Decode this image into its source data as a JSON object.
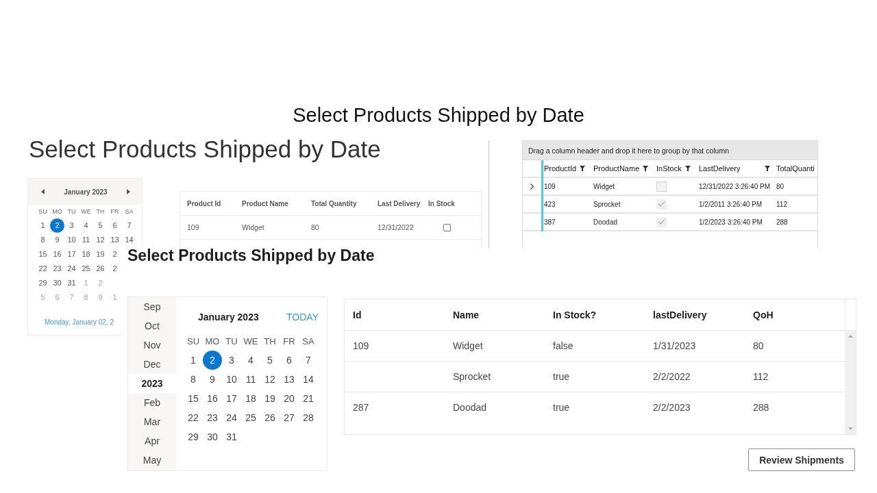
{
  "slide": {
    "title": "Select Products Shipped by Date"
  },
  "top_left_screenshot": {
    "heading": "Select Products Shipped by Date",
    "calendar": {
      "month": "January 2023",
      "weekdays": [
        "SU",
        "MO",
        "TU",
        "WE",
        "TH",
        "FR",
        "SA"
      ],
      "weeks": [
        [
          {
            "day": "1",
            "selected": false,
            "outside": false
          },
          {
            "day": "2",
            "selected": true,
            "outside": false
          },
          {
            "day": "3",
            "selected": false,
            "outside": false
          },
          {
            "day": "4",
            "selected": false,
            "outside": false
          },
          {
            "day": "5",
            "selected": false,
            "outside": false
          },
          {
            "day": "6",
            "selected": false,
            "outside": false
          },
          {
            "day": "7",
            "selected": false,
            "outside": false
          }
        ],
        [
          {
            "day": "8",
            "selected": false,
            "outside": false
          },
          {
            "day": "9",
            "selected": false,
            "outside": false
          },
          {
            "day": "10",
            "selected": false,
            "outside": false
          },
          {
            "day": "11",
            "selected": false,
            "outside": false
          },
          {
            "day": "12",
            "selected": false,
            "outside": false
          },
          {
            "day": "13",
            "selected": false,
            "outside": false
          },
          {
            "day": "14",
            "selected": false,
            "outside": false
          }
        ],
        [
          {
            "day": "15",
            "selected": false,
            "outside": false
          },
          {
            "day": "16",
            "selected": false,
            "outside": false
          },
          {
            "day": "17",
            "selected": false,
            "outside": false
          },
          {
            "day": "18",
            "selected": false,
            "outside": false
          },
          {
            "day": "19",
            "selected": false,
            "outside": false
          },
          {
            "day": "2",
            "selected": false,
            "outside": false
          }
        ],
        [
          {
            "day": "22",
            "selected": false,
            "outside": false
          },
          {
            "day": "23",
            "selected": false,
            "outside": false
          },
          {
            "day": "24",
            "selected": false,
            "outside": false
          },
          {
            "day": "25",
            "selected": false,
            "outside": false
          },
          {
            "day": "26",
            "selected": false,
            "outside": false
          },
          {
            "day": "2",
            "selected": false,
            "outside": false
          }
        ],
        [
          {
            "day": "29",
            "selected": false,
            "outside": false
          },
          {
            "day": "30",
            "selected": false,
            "outside": false
          },
          {
            "day": "31",
            "selected": false,
            "outside": false
          },
          {
            "day": "1",
            "selected": false,
            "outside": true
          },
          {
            "day": "2",
            "selected": false,
            "outside": true
          }
        ],
        [
          {
            "day": "5",
            "selected": false,
            "outside": true
          },
          {
            "day": "6",
            "selected": false,
            "outside": true
          },
          {
            "day": "7",
            "selected": false,
            "outside": true
          },
          {
            "day": "8",
            "selected": false,
            "outside": true
          },
          {
            "day": "9",
            "selected": false,
            "outside": true
          },
          {
            "day": "1",
            "selected": false,
            "outside": true
          }
        ]
      ],
      "footer_link": "Monday, January 02, 2"
    },
    "table": {
      "columns": [
        {
          "label": "Product Id",
          "kind": "text"
        },
        {
          "label": "Product Name",
          "kind": "text"
        },
        {
          "label": "Total Quantity",
          "kind": "text"
        },
        {
          "label": "Last Delivery",
          "kind": "text"
        },
        {
          "label": "In Stock",
          "kind": "check"
        }
      ],
      "rows": [
        {
          "cells": [
            "109",
            "Widget",
            "80",
            "12/31/2022",
            {
              "checked": false
            }
          ]
        }
      ]
    }
  },
  "top_right_screenshot": {
    "group_hint": "Drag a column header and drop it here to group by that column",
    "columns": [
      {
        "label": "ProductId",
        "kind": "text",
        "filter": true
      },
      {
        "label": "ProductName",
        "kind": "text",
        "filter": true
      },
      {
        "label": "InStock",
        "kind": "check",
        "filter": true
      },
      {
        "label": "LastDelivery",
        "kind": "text",
        "filter": true
      },
      {
        "label": "TotalQuanti",
        "kind": "text",
        "filter": false
      }
    ],
    "rows": [
      {
        "current": true,
        "cells": [
          "109",
          "Widget",
          {
            "checked": false
          },
          "12/31/2022 3:26:40 PM",
          "80"
        ]
      },
      {
        "current": false,
        "cells": [
          "423",
          "Sprocket",
          {
            "checked": true
          },
          "1/2/2011 3:26:40 PM",
          "112"
        ]
      },
      {
        "current": false,
        "cells": [
          "387",
          "Doodad",
          {
            "checked": true
          },
          "1/2/2023 3:26:40 PM",
          "288"
        ]
      }
    ]
  },
  "bottom_screenshot": {
    "heading": "Select Products Shipped by Date",
    "calendar": {
      "months": [
        {
          "label": "Sep",
          "selected": false
        },
        {
          "label": "Oct",
          "selected": false
        },
        {
          "label": "Nov",
          "selected": false
        },
        {
          "label": "Dec",
          "selected": false
        },
        {
          "label": "2023",
          "selected": true
        },
        {
          "label": "Feb",
          "selected": false
        },
        {
          "label": "Mar",
          "selected": false
        },
        {
          "label": "Apr",
          "selected": false
        },
        {
          "label": "May",
          "selected": false
        }
      ],
      "title": "January 2023",
      "today": "TODAY",
      "weekdays": [
        "SU",
        "MO",
        "TU",
        "WE",
        "TH",
        "FR",
        "SA"
      ],
      "weeks": [
        [
          {
            "day": "1",
            "selected": false
          },
          {
            "day": "2",
            "selected": true
          },
          {
            "day": "3",
            "selected": false
          },
          {
            "day": "4",
            "selected": false
          },
          {
            "day": "5",
            "selected": false
          },
          {
            "day": "6",
            "selected": false
          },
          {
            "day": "7",
            "selected": false
          }
        ],
        [
          {
            "day": "8",
            "selected": false
          },
          {
            "day": "9",
            "selected": false
          },
          {
            "day": "10",
            "selected": false
          },
          {
            "day": "11",
            "selected": false
          },
          {
            "day": "12",
            "selected": false
          },
          {
            "day": "13",
            "selected": false
          },
          {
            "day": "14",
            "selected": false
          }
        ],
        [
          {
            "day": "15",
            "selected": false
          },
          {
            "day": "16",
            "selected": false
          },
          {
            "day": "17",
            "selected": false
          },
          {
            "day": "18",
            "selected": false
          },
          {
            "day": "19",
            "selected": false
          },
          {
            "day": "20",
            "selected": false
          },
          {
            "day": "21",
            "selected": false
          }
        ],
        [
          {
            "day": "22",
            "selected": false
          },
          {
            "day": "23",
            "selected": false
          },
          {
            "day": "24",
            "selected": false
          },
          {
            "day": "25",
            "selected": false
          },
          {
            "day": "26",
            "selected": false
          },
          {
            "day": "27",
            "selected": false
          },
          {
            "day": "28",
            "selected": false
          }
        ],
        [
          {
            "day": "29",
            "selected": false
          },
          {
            "day": "30",
            "selected": false
          },
          {
            "day": "31",
            "selected": false
          }
        ]
      ]
    },
    "table": {
      "columns": [
        "Id",
        "Name",
        "In Stock?",
        "lastDelivery",
        "QoH"
      ],
      "rows": [
        {
          "cells": [
            "109",
            "Widget",
            "false",
            "1/31/2023",
            "80"
          ]
        },
        {
          "cells": [
            null,
            "Sprocket",
            "true",
            "2/2/2022",
            "112"
          ]
        },
        {
          "cells": [
            "287",
            "Doodad",
            "true",
            "2/2/2023",
            "288"
          ]
        }
      ]
    },
    "button": "Review Shipments"
  }
}
